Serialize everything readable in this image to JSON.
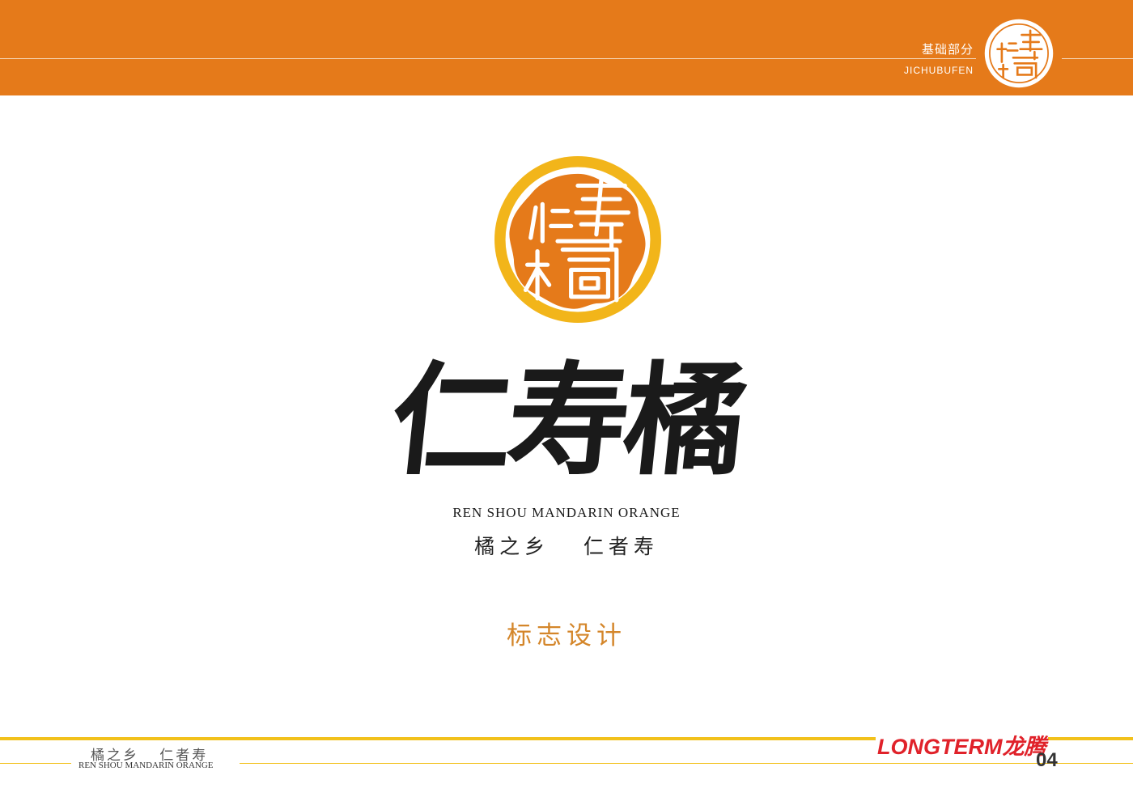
{
  "header": {
    "section_cn": "基础部分",
    "section_en": "JICHUBUFEN"
  },
  "logo": {
    "name_cn": "仁寿橘",
    "name_en": "REN SHOU MANDARIN ORANGE",
    "slogan": "橘之乡   仁者寿"
  },
  "section_title": "标志设计",
  "footer": {
    "slogan": "橘之乡   仁者寿",
    "name_en": "REN SHOU MANDARIN ORANGE",
    "company": "LONGTERM龙腾",
    "page_number": "04"
  },
  "colors": {
    "brand_orange": "#E57A1A",
    "emblem_yellow": "#F2B51A",
    "accent_gold": "#D4862A",
    "company_red": "#E0222A"
  }
}
